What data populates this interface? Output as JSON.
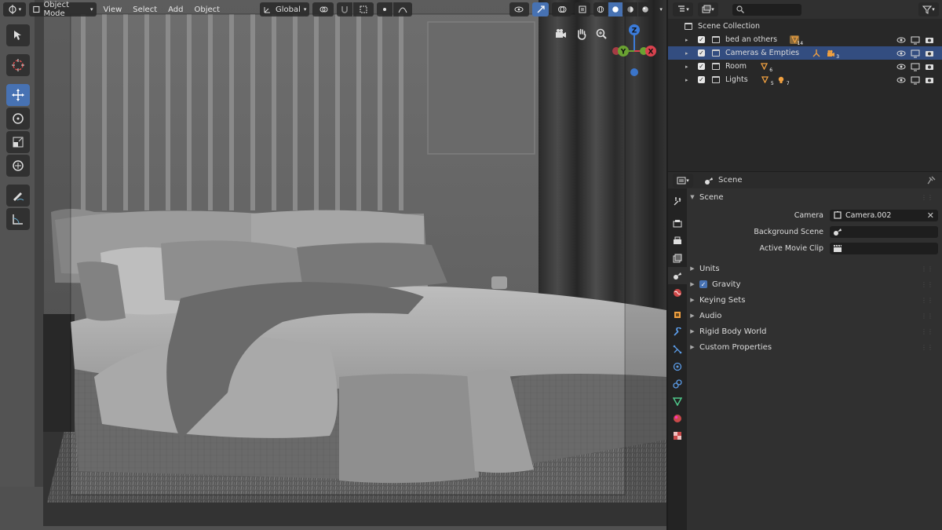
{
  "viewport": {
    "mode_label": "Object Mode",
    "menus": [
      "View",
      "Select",
      "Add",
      "Object"
    ],
    "orientation_label": "Global",
    "gizmo_axes": {
      "z": "Z",
      "y": "Y",
      "x": "X"
    },
    "colors": {
      "accent": "#4772b3",
      "x_axis": "#d9424e",
      "y_axis": "#6aa232",
      "z_axis": "#3b7bd9"
    }
  },
  "toolbar": {
    "tools": [
      "select-box-icon",
      "cursor-icon",
      "move-icon",
      "rotate-icon",
      "scale-icon",
      "transform-icon",
      "annotate-icon",
      "measure-icon"
    ],
    "active_tool": "move-icon"
  },
  "outliner": {
    "search_placeholder": "",
    "root_label": "Scene Collection",
    "rows": [
      {
        "name": "bed an others",
        "badge_count": "14",
        "selected": false
      },
      {
        "name": "Cameras & Empties",
        "badge_count": "3",
        "selected": true
      },
      {
        "name": "Room",
        "badge_count": "6",
        "selected": false
      },
      {
        "name": "Lights",
        "badge_count": "5",
        "badge2_count": "7",
        "selected": false
      }
    ]
  },
  "properties": {
    "context_label": "Scene",
    "panel_title": "Scene",
    "fields": {
      "camera_label": "Camera",
      "camera_value": "Camera.002",
      "background_label": "Background Scene",
      "background_value": "",
      "movieclip_label": "Active Movie Clip",
      "movieclip_value": ""
    },
    "subpanels": {
      "units": "Units",
      "gravity": "Gravity",
      "keying_sets": "Keying Sets",
      "audio": "Audio",
      "rigid_body": "Rigid Body World",
      "custom_props": "Custom Properties"
    },
    "tabs": [
      "tool-icon",
      "render-icon",
      "output-icon",
      "view-layer-icon",
      "scene-icon",
      "world-icon",
      "object-icon",
      "modifier-icon",
      "particles-icon",
      "physics-icon",
      "constraints-icon",
      "data-icon",
      "material-icon",
      "texture-icon"
    ],
    "active_tab": "scene-icon"
  }
}
